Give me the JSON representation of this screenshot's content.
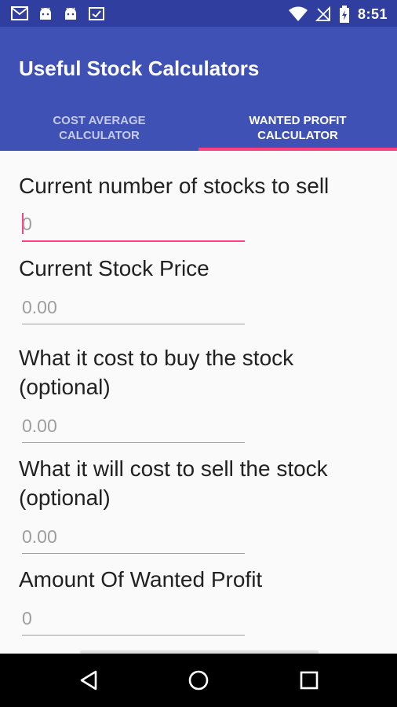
{
  "status_bar": {
    "time": "8:51",
    "left_icons": [
      "gmail-icon",
      "android-icon",
      "android-icon",
      "clipboard-check-icon"
    ],
    "right_icons": [
      "wifi-icon",
      "no-signal-icon",
      "battery-charging-icon"
    ]
  },
  "app_bar": {
    "title": "Useful Stock Calculators",
    "tabs": [
      {
        "label": "COST AVERAGE\nCALCULATOR",
        "active": false
      },
      {
        "label": "WANTED PROFIT\nCALCULATOR",
        "active": true
      }
    ]
  },
  "form": {
    "fields": [
      {
        "label": "Current number of stocks to sell",
        "value": "0",
        "focused": true
      },
      {
        "label": "Current Stock Price",
        "value": "0.00"
      },
      {
        "label": "What it cost to buy the stock\n(optional)",
        "value": "0.00"
      },
      {
        "label": "What it will cost to sell the stock\n(optional)",
        "value": "0.00"
      },
      {
        "label": "Amount Of Wanted Profit",
        "value": "0"
      }
    ]
  },
  "nav_bar": {
    "buttons": [
      "back-icon",
      "home-icon",
      "recents-icon"
    ]
  },
  "colors": {
    "primary": "#3f51b5",
    "primary_dark": "#303f9f",
    "accent": "#ff4081"
  }
}
